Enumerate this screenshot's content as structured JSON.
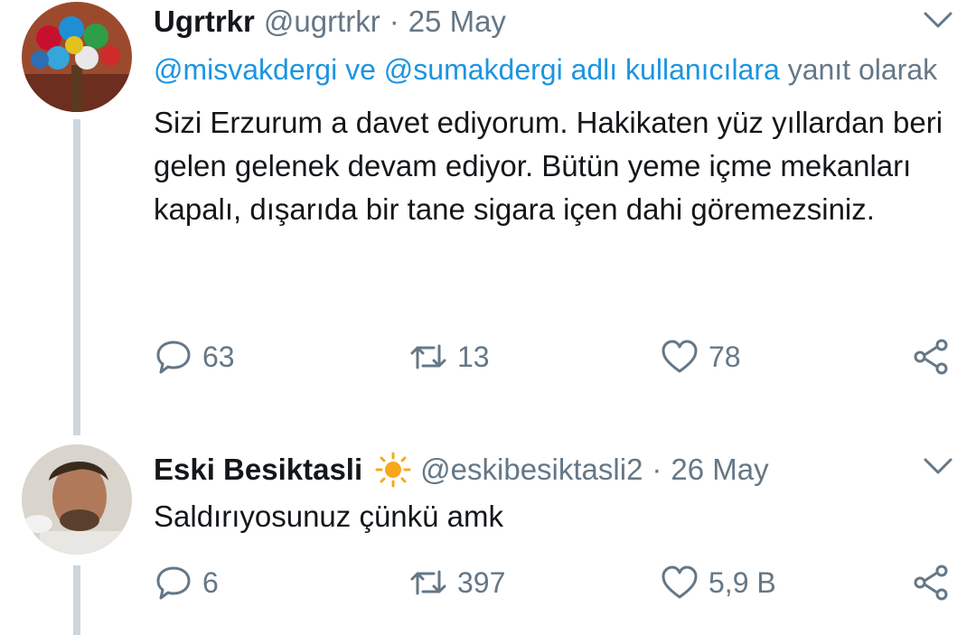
{
  "tweets": [
    {
      "name": "Ugrtrkr",
      "handle": "@ugrtrkr",
      "separator": "·",
      "date": "25 May",
      "reply_prefix_mentions": "@misvakdergi ve @sumakdergi adlı kullanıcılara",
      "reply_suffix": " yanıt olarak",
      "text": "Sizi Erzurum a davet ediyorum. Hakikaten yüz yıllardan beri gelen gelenek devam ediyor. Bütün yeme içme mekanları kapalı, dışarıda bir tane sigara içen dahi göremezsiniz.",
      "replies": "63",
      "retweets": "13",
      "likes": "78"
    },
    {
      "name": "Eski Besiktasli",
      "handle": "@eskibesiktasli2",
      "separator": "·",
      "date": "26 May",
      "text": "Saldırıyosunuz çünkü amk",
      "replies": "6",
      "retweets": "397",
      "likes": "5,9 B"
    }
  ],
  "colors": {
    "link": "#1b95e0",
    "muted": "#657786",
    "sun": "#f7a81b",
    "thread_line": "#cdd6dd"
  }
}
